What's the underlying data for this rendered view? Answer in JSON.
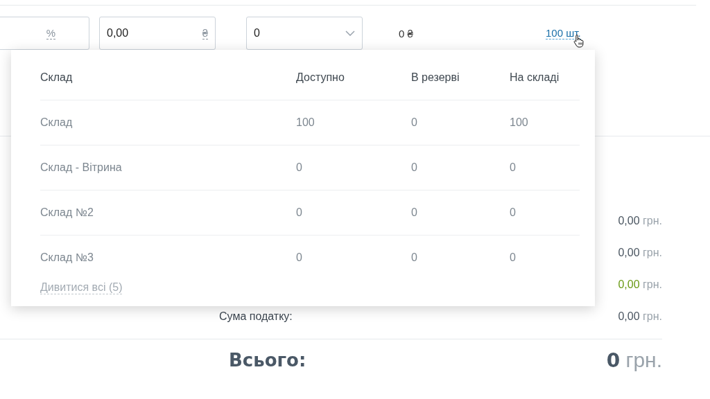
{
  "line_item": {
    "fields": [
      {
        "kind": "input",
        "suffix": "%"
      },
      {
        "kind": "input",
        "value": "0,00",
        "suffix": "₴"
      },
      {
        "kind": "select",
        "value": "0"
      }
    ],
    "sum": "0 ₴",
    "stock_link": "100 шт."
  },
  "stock_popup": {
    "columns": [
      "Склад",
      "Доступно",
      "В резерві",
      "На складі"
    ],
    "rows": [
      [
        "Склад",
        "100",
        "0",
        "100"
      ],
      [
        "Склад - Вітрина",
        "0",
        "0",
        "0"
      ],
      [
        "Склад №2",
        "0",
        "0",
        "0"
      ],
      [
        "Склад №3",
        "0",
        "0",
        "0"
      ]
    ],
    "view_all": "Дивитися всі (5)"
  },
  "totals": {
    "rows": [
      {
        "kind": "plain",
        "value": "0,00",
        "unit": "грн."
      },
      {
        "kind": "plain",
        "value": "0,00",
        "unit": "грн."
      },
      {
        "kind": "positive",
        "value": "0,00",
        "unit": "грн."
      },
      {
        "kind": "plain",
        "label": "Сума податку:",
        "value": "0,00",
        "unit": "грн."
      }
    ],
    "grand_total": {
      "label": "Всього:",
      "value": "0",
      "unit": "грн."
    }
  }
}
